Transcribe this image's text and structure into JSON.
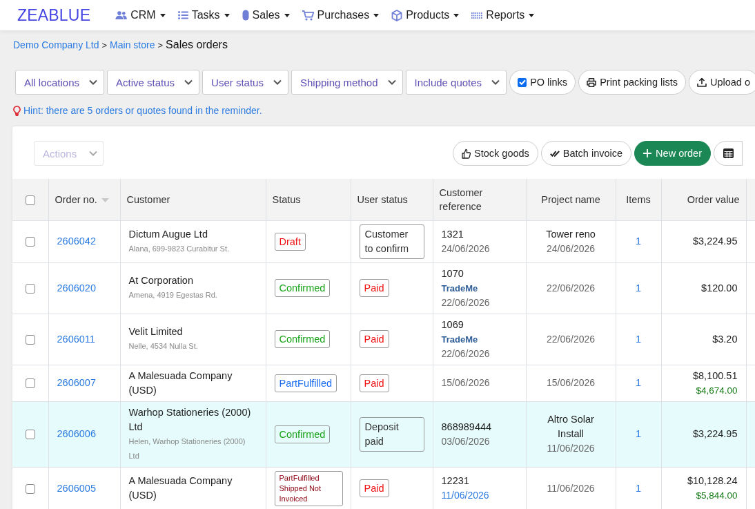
{
  "brand": "ZEABLUE",
  "nav": [
    {
      "label": "CRM"
    },
    {
      "label": "Tasks"
    },
    {
      "label": "Sales"
    },
    {
      "label": "Purchases"
    },
    {
      "label": "Products"
    },
    {
      "label": "Reports"
    }
  ],
  "breadcrumb": [
    {
      "kind": "link",
      "label": "Demo Company Ltd"
    },
    {
      "kind": "separator",
      "label": ">"
    },
    {
      "kind": "link",
      "label": "Main store"
    },
    {
      "kind": "separator",
      "label": ">"
    },
    {
      "kind": "current",
      "label": "Sales orders"
    }
  ],
  "filters": {
    "selects": [
      {
        "label": "All locations"
      },
      {
        "label": "Active status"
      },
      {
        "label": "User status"
      },
      {
        "label": "Shipping method"
      },
      {
        "label": "Include quotes"
      }
    ],
    "po_links": {
      "label": "PO links",
      "checked": true
    },
    "buttons": [
      {
        "label": "Print packing lists"
      },
      {
        "label": "Upload o"
      }
    ]
  },
  "hint": "Hint: there are 5 orders or quotes found in the reminder.",
  "toolbar": {
    "actions": {
      "label": "Actions",
      "disabled": true
    },
    "buttons": [
      {
        "kind": "outline",
        "label": "Stock goods"
      },
      {
        "kind": "outline",
        "label": "Batch invoice"
      },
      {
        "kind": "primary",
        "label": "New order"
      },
      {
        "kind": "icon"
      }
    ]
  },
  "table": {
    "select_all": {
      "checked": false
    },
    "columns": [
      {
        "label": "Order no.",
        "sorted": true
      },
      {
        "label": "Customer",
        "sorted": false
      },
      {
        "label": "Status",
        "sorted": false
      },
      {
        "label": "User status",
        "sorted": false
      },
      {
        "label": "Customer reference",
        "sorted": false
      },
      {
        "label": "Project name",
        "sorted": false
      },
      {
        "label": "Items",
        "sorted": false
      },
      {
        "label": "Order value",
        "sorted": false
      }
    ],
    "rows": [
      {
        "checked": false,
        "highlighted": false,
        "order_no": "2606042",
        "customer": {
          "name": "Dictum Augue Ltd",
          "contact": "Alana, 699-9823 Curabitur St."
        },
        "status": {
          "kind": "draft",
          "label": "Draft"
        },
        "user_status": {
          "kind": "note",
          "label": "Customer to confirm"
        },
        "reference": {
          "number": "1321",
          "date": "24/06/2026",
          "date_link": false
        },
        "project": {
          "name": "Tower reno",
          "date": "24/06/2026"
        },
        "items": "1",
        "order_value": {
          "total": "$3,224.95"
        }
      },
      {
        "checked": false,
        "highlighted": false,
        "order_no": "2606020",
        "customer": {
          "name": "At Corporation",
          "contact": "Amena, 4919 Egestas Rd."
        },
        "status": {
          "kind": "confirmed",
          "label": "Confirmed"
        },
        "user_status": {
          "kind": "paid",
          "label": "Paid"
        },
        "reference": {
          "number": "1070",
          "tag": "TradeMe",
          "date": "22/06/2026",
          "date_link": false
        },
        "project": {
          "date": "22/06/2026"
        },
        "items": "1",
        "order_value": {
          "total": "$120.00"
        }
      },
      {
        "checked": false,
        "highlighted": false,
        "order_no": "2606011",
        "customer": {
          "name": "Velit Limited",
          "contact": "Nelle, 4534 Nulla St."
        },
        "status": {
          "kind": "confirmed",
          "label": "Confirmed"
        },
        "user_status": {
          "kind": "paid",
          "label": "Paid"
        },
        "reference": {
          "number": "1069",
          "tag": "TradeMe",
          "date": "22/06/2026",
          "date_link": false
        },
        "project": {
          "date": "22/06/2026"
        },
        "items": "1",
        "order_value": {
          "total": "$3.20"
        }
      },
      {
        "checked": false,
        "highlighted": false,
        "order_no": "2606007",
        "customer": {
          "name": "A Malesuada Company (USD)"
        },
        "status": {
          "kind": "partfulfilled",
          "label": "PartFulfilled"
        },
        "user_status": {
          "kind": "paid",
          "label": "Paid"
        },
        "reference": {
          "date": "15/06/2026",
          "date_link": false
        },
        "project": {
          "date": "15/06/2026"
        },
        "items": "1",
        "order_value": {
          "total": "$8,100.51",
          "second_amount": "$4,674.00"
        }
      },
      {
        "checked": false,
        "highlighted": true,
        "order_no": "2606006",
        "customer": {
          "name": "Warhop Stationeries (2000) Ltd",
          "contact": "Helen, Warhop Stationeries (2000) Ltd"
        },
        "status": {
          "kind": "confirmed",
          "label": "Confirmed"
        },
        "user_status": {
          "kind": "note",
          "label": "Deposit paid"
        },
        "reference": {
          "number": "868989444",
          "date": "03/06/2026",
          "date_link": false
        },
        "project": {
          "name": "Altro Solar Install",
          "date": "11/06/2026"
        },
        "items": "1",
        "order_value": {
          "total": "$3,224.95"
        }
      },
      {
        "checked": false,
        "highlighted": false,
        "order_no": "2606005",
        "customer": {
          "name": "A Malesuada Company (USD)"
        },
        "status": {
          "kind": "alert",
          "label": "PartFulfilled Shipped Not Invoiced"
        },
        "user_status": {
          "kind": "paid",
          "label": "Paid"
        },
        "reference": {
          "number": "12231",
          "date": "11/06/2026",
          "date_link": true
        },
        "project": {
          "date": "11/06/2026"
        },
        "items": "1",
        "order_value": {
          "total": "$10,128.24",
          "second_amount": "$5,844.00"
        }
      }
    ]
  }
}
